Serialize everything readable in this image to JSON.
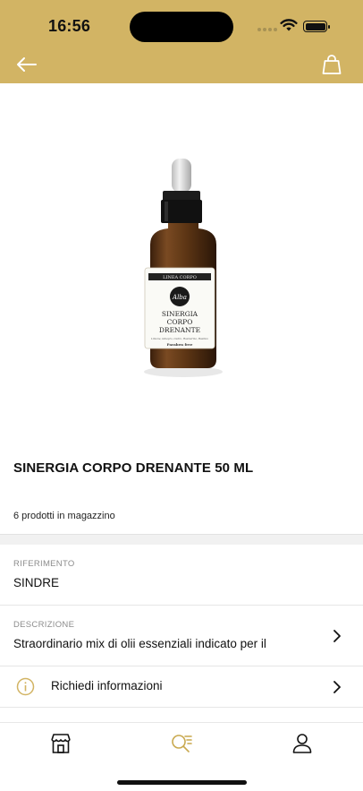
{
  "status_bar": {
    "time": "16:56"
  },
  "header": {
    "background_color": "#d2b464",
    "back_icon": "arrow-left-icon",
    "cart_icon": "shopping-bag-icon"
  },
  "product": {
    "image_label": {
      "line": "LINEA CORPO",
      "brand": "Alba",
      "name_line1": "SINERGIA",
      "name_line2": "CORPO",
      "name_line3": "DRENANTE",
      "ingredients": "Limone, Ginepro, Cedro, Rosmarino, Basilico",
      "badge": "Paraben free"
    },
    "title": "SINERGIA CORPO DRENANTE 50 ML",
    "stock": "6 prodotti in magazzino"
  },
  "fields": {
    "reference": {
      "label": "RIFERIMENTO",
      "value": "SINDRE"
    },
    "description": {
      "label": "DESCRIZIONE",
      "value": "Straordinario mix di olii essenziali indicato per il"
    }
  },
  "actions": {
    "request_info": "Richiedi informazioni"
  },
  "tabbar": {
    "items": [
      {
        "icon": "store-icon",
        "active": false
      },
      {
        "icon": "search-list-icon",
        "active": true
      },
      {
        "icon": "user-icon",
        "active": false
      }
    ],
    "active_color": "#c9a94f"
  }
}
